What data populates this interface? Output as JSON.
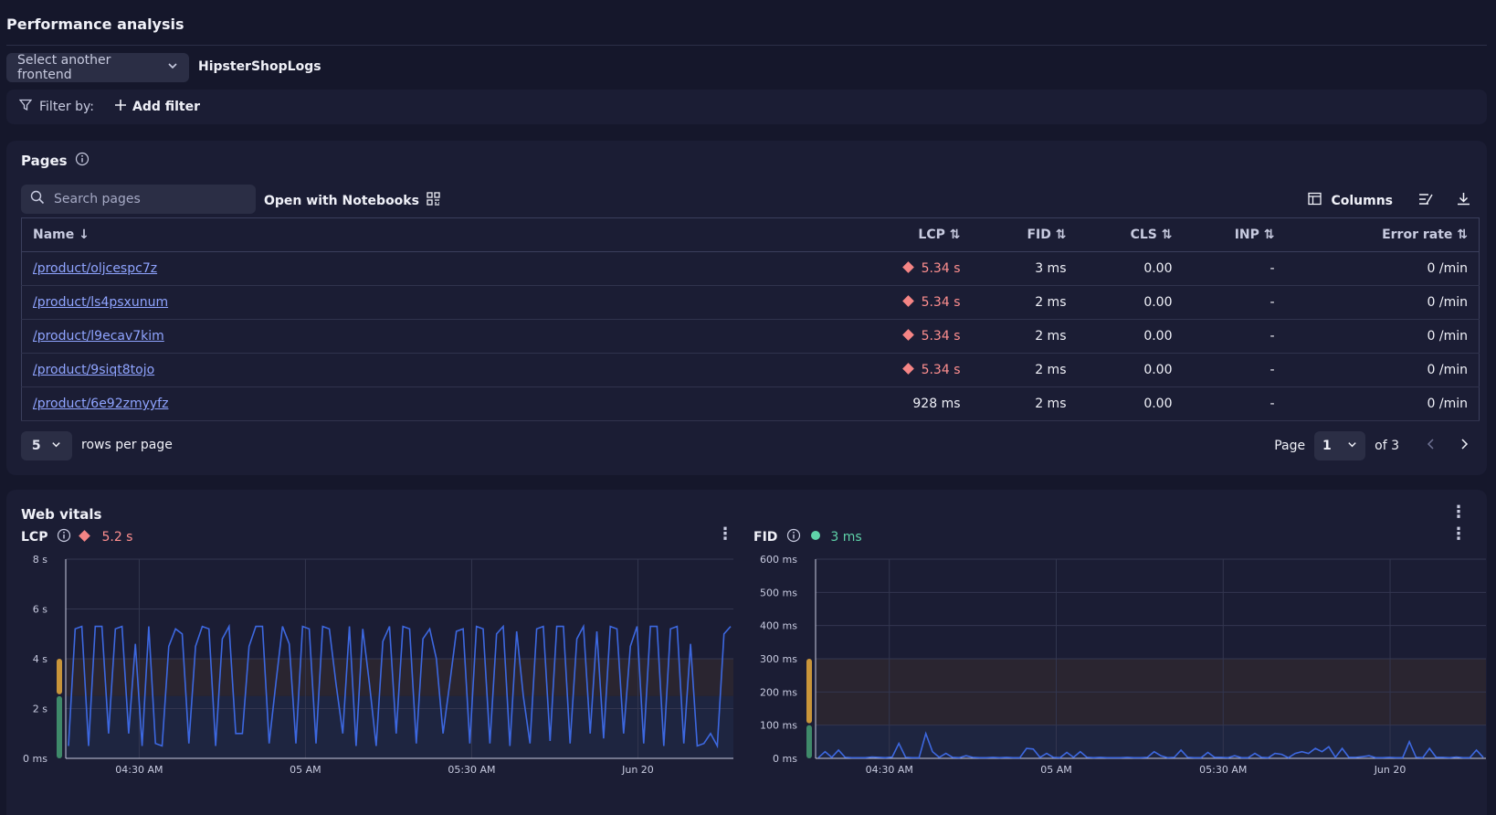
{
  "header": {
    "title": "Performance analysis",
    "select_frontend_label": "Select another frontend",
    "frontend_name": "HipsterShopLogs"
  },
  "filter": {
    "label": "Filter by:",
    "add_label": "Add filter"
  },
  "pages": {
    "title": "Pages",
    "search_placeholder": "Search pages",
    "notebooks_label": "Open with Notebooks",
    "columns_label": "Columns",
    "columns": [
      "Name",
      "LCP",
      "FID",
      "CLS",
      "INP",
      "Error rate"
    ],
    "rows": [
      {
        "name": "/product/oljcespc7z",
        "lcp": "5.34 s",
        "lcp_warn": true,
        "fid": "3 ms",
        "cls": "0.00",
        "inp": "-",
        "error_rate": "0 /min"
      },
      {
        "name": "/product/ls4psxunum",
        "lcp": "5.34 s",
        "lcp_warn": true,
        "fid": "2 ms",
        "cls": "0.00",
        "inp": "-",
        "error_rate": "0 /min"
      },
      {
        "name": "/product/l9ecav7kim",
        "lcp": "5.34 s",
        "lcp_warn": true,
        "fid": "2 ms",
        "cls": "0.00",
        "inp": "-",
        "error_rate": "0 /min"
      },
      {
        "name": "/product/9siqt8tojo",
        "lcp": "5.34 s",
        "lcp_warn": true,
        "fid": "2 ms",
        "cls": "0.00",
        "inp": "-",
        "error_rate": "0 /min"
      },
      {
        "name": "/product/6e92zmyyfz",
        "lcp": "928 ms",
        "lcp_warn": false,
        "fid": "2 ms",
        "cls": "0.00",
        "inp": "-",
        "error_rate": "0 /min"
      }
    ],
    "rows_per_page": "5",
    "rows_per_page_label": "rows per page",
    "page_label": "Page",
    "page_current": "1",
    "page_total": "of 3"
  },
  "vitals": {
    "title": "Web vitals",
    "lcp": {
      "label": "LCP",
      "value": "5.2 s",
      "status_color": "#f58585"
    },
    "fid": {
      "label": "FID",
      "value": "3 ms",
      "status_color": "#5fd3a9"
    }
  },
  "colors": {
    "accent": "#8fa4ff",
    "warn": "#f58585",
    "good": "#5fd3a9",
    "line": "#3d68e0"
  },
  "chart_data": [
    {
      "type": "line",
      "name": "LCP",
      "ylabel_ticks": [
        "0 ms",
        "2 s",
        "4 s",
        "6 s",
        "8 s"
      ],
      "ylim": [
        0,
        8
      ],
      "xticks": [
        "04:30 AM",
        "05 AM",
        "05:30 AM",
        "Jun 20"
      ],
      "thresholds": {
        "good": 2.5,
        "needs_improvement": 4
      },
      "values": [
        0.5,
        5.2,
        5.3,
        0.5,
        5.3,
        5.3,
        1,
        5.2,
        5.3,
        1,
        4.6,
        0.5,
        5.3,
        0.6,
        0.5,
        4.5,
        5.2,
        5,
        0.6,
        4.5,
        5.3,
        5.2,
        0.5,
        4.8,
        5.3,
        1,
        1,
        4.5,
        5.3,
        5.3,
        0.6,
        3,
        5.3,
        4.6,
        0.6,
        5.3,
        5.2,
        0.6,
        5.3,
        5.2,
        3,
        1,
        5.3,
        0.5,
        5.2,
        3,
        0.5,
        4.7,
        5.3,
        1,
        5.3,
        5.2,
        0.6,
        4.8,
        5.2,
        4,
        1,
        3,
        5.1,
        5.2,
        0.6,
        5.3,
        5.2,
        0.6,
        5,
        5.3,
        0.5,
        5.1,
        2.5,
        0.6,
        5.2,
        5.3,
        0.7,
        5.3,
        5.3,
        0.6,
        4.8,
        5.3,
        1,
        5.1,
        0.8,
        5.3,
        5.2,
        1,
        4.5,
        5.3,
        0.6,
        5.3,
        5.3,
        0.5,
        5.2,
        5.3,
        0.6,
        4.6,
        0.5,
        0.6,
        1,
        0.5,
        5,
        5.3
      ]
    },
    {
      "type": "line",
      "name": "FID",
      "ylabel_ticks": [
        "0 ms",
        "100 ms",
        "200 ms",
        "300 ms",
        "400 ms",
        "500 ms",
        "600 ms"
      ],
      "ylim": [
        0,
        600
      ],
      "xticks": [
        "04:30 AM",
        "05 AM",
        "05:30 AM",
        "Jun 20"
      ],
      "thresholds": {
        "good": 100,
        "needs_improvement": 300
      },
      "values": [
        2,
        20,
        3,
        25,
        3,
        2,
        2,
        2,
        4,
        3,
        2,
        4,
        45,
        3,
        2,
        2,
        75,
        20,
        3,
        15,
        3,
        2,
        8,
        3,
        2,
        2,
        3,
        2,
        3,
        2,
        2,
        30,
        28,
        3,
        15,
        3,
        2,
        18,
        3,
        20,
        3,
        2,
        3,
        2,
        2,
        2,
        3,
        2,
        2,
        3,
        20,
        8,
        2,
        3,
        25,
        3,
        2,
        2,
        18,
        3,
        3,
        2,
        8,
        2,
        2,
        15,
        3,
        2,
        15,
        12,
        2,
        15,
        20,
        15,
        30,
        20,
        35,
        3,
        30,
        3,
        3,
        5,
        8,
        2,
        2,
        3,
        2,
        2,
        50,
        3,
        2,
        30,
        3,
        3,
        2,
        4,
        2,
        2,
        25,
        3
      ]
    }
  ]
}
